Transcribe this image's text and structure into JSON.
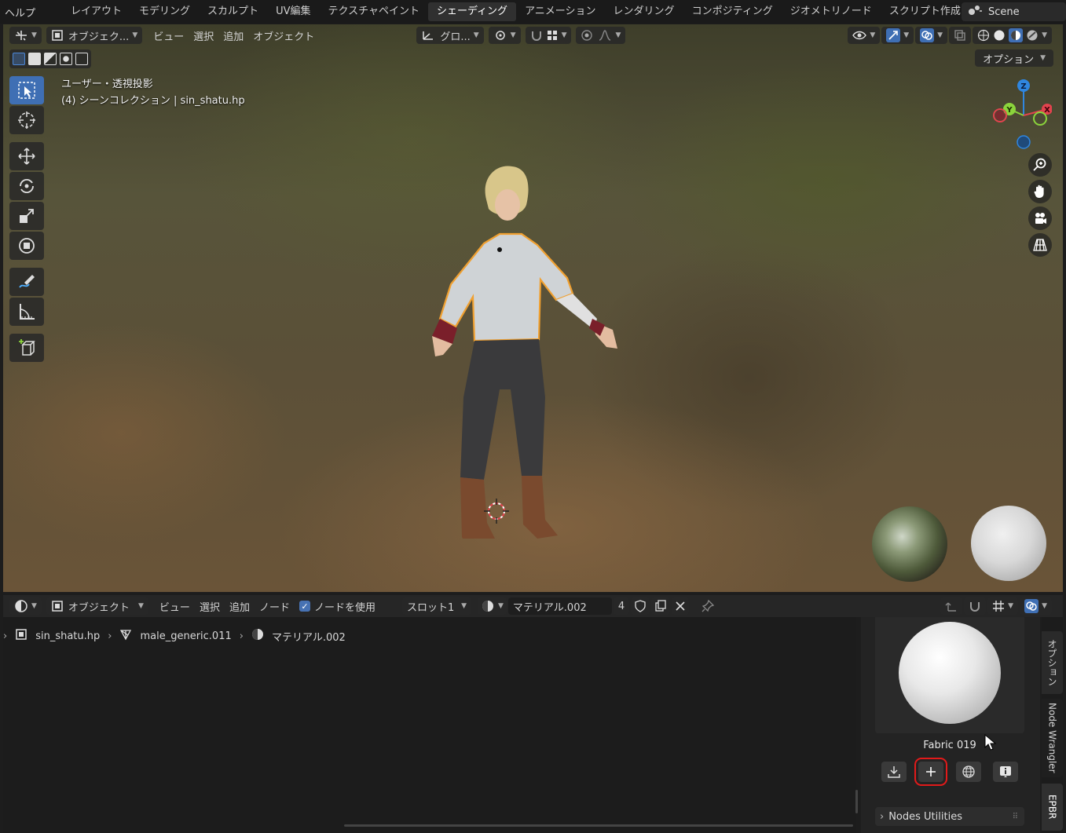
{
  "topbar": {
    "help_label": "ヘルプ",
    "tabs": [
      "レイアウト",
      "モデリング",
      "スカルプト",
      "UV編集",
      "テクスチャペイント",
      "シェーディング",
      "アニメーション",
      "レンダリング",
      "コンポジティング",
      "ジオメトリノード",
      "スクリプト作成"
    ],
    "active_tab": "シェーディング",
    "scene_name": "Scene"
  },
  "viewport": {
    "mode_label": "オブジェク...",
    "menu_view": "ビュー",
    "menu_select": "選択",
    "menu_add": "追加",
    "menu_object": "オブジェクト",
    "transform_orientation": "グロ...",
    "options_label": "オプション",
    "info_line1": "ユーザー・透視投影",
    "info_line2": "(4) シーンコレクション | sin_shatu.hp",
    "gizmo_axes": {
      "z": "Z",
      "y": "Y",
      "x": "X"
    },
    "colors": {
      "x_axis": "#e2434e",
      "y_axis": "#8bd43c",
      "z_axis": "#2f86e0",
      "selection_outline": "#f0a030",
      "active_tool": "#3f6fb4"
    }
  },
  "node_editor": {
    "mode_label": "オブジェクト",
    "menu_view": "ビュー",
    "menu_select": "選択",
    "menu_add": "追加",
    "menu_node": "ノード",
    "use_nodes_label": "ノードを使用",
    "use_nodes_checked": true,
    "slot_label": "スロット1",
    "material_name": "マテリアル.002",
    "user_count": "4",
    "breadcrumb": [
      "sin_shatu.hp",
      "male_generic.011",
      "マテリアル.002"
    ]
  },
  "side_panel": {
    "asset_name": "Fabric 019",
    "nodes_utilities_label": "Nodes Utilities",
    "tabs": [
      "オプション",
      "Node Wrangler",
      "EPBR"
    ]
  },
  "highlight_color": "#e21a1a"
}
